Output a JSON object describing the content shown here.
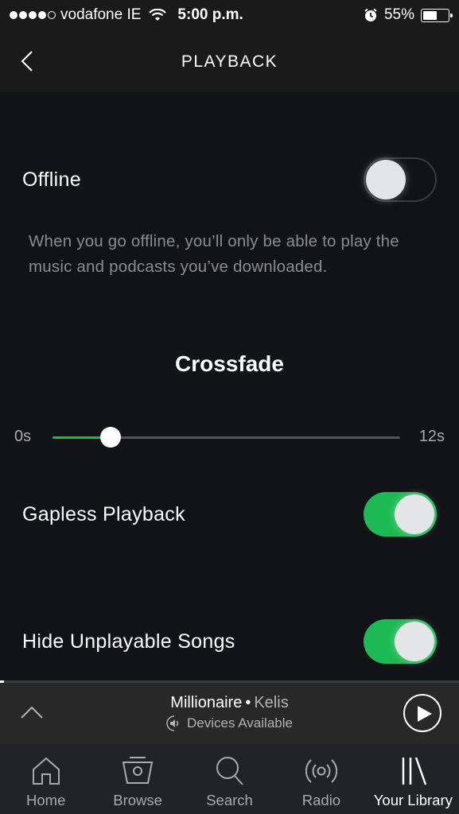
{
  "status_bar": {
    "signal_filled": 4,
    "signal_total": 5,
    "carrier": "vodafone IE",
    "time": "5:00 p.m.",
    "alarm_icon": "alarm-clock-icon",
    "battery_percent": "55%",
    "battery_level": 0.55
  },
  "nav": {
    "title": "PLAYBACK",
    "back_icon": "chevron-left-icon"
  },
  "settings": {
    "offline": {
      "label": "Offline",
      "enabled": false,
      "description": "When you go offline, you’ll only be able to play the music and podcasts you’ve downloaded."
    },
    "crossfade": {
      "title": "Crossfade",
      "min_label": "0s",
      "max_label": "12s",
      "min": 0,
      "max": 12,
      "value": 2
    },
    "gapless": {
      "label": "Gapless Playback",
      "enabled": true
    },
    "hide_unplayable": {
      "label": "Hide Unplayable Songs",
      "enabled": true
    }
  },
  "mini_player": {
    "title": "Millionaire",
    "separator": "•",
    "artist": "Kelis",
    "devices_label": "Devices Available",
    "progress": 0.005
  },
  "tabs": [
    {
      "label": "Home",
      "icon": "home-icon",
      "active": false
    },
    {
      "label": "Browse",
      "icon": "browse-icon",
      "active": false
    },
    {
      "label": "Search",
      "icon": "search-icon",
      "active": false
    },
    {
      "label": "Radio",
      "icon": "radio-icon",
      "active": false
    },
    {
      "label": "Your Library",
      "icon": "library-icon",
      "active": true
    }
  ],
  "colors": {
    "accent_green": "#1db954",
    "background": "#121316",
    "header": "#1a1a1b",
    "mini_player": "#282829",
    "tab_bar": "#222326",
    "muted_text": "#8b8c8f"
  }
}
